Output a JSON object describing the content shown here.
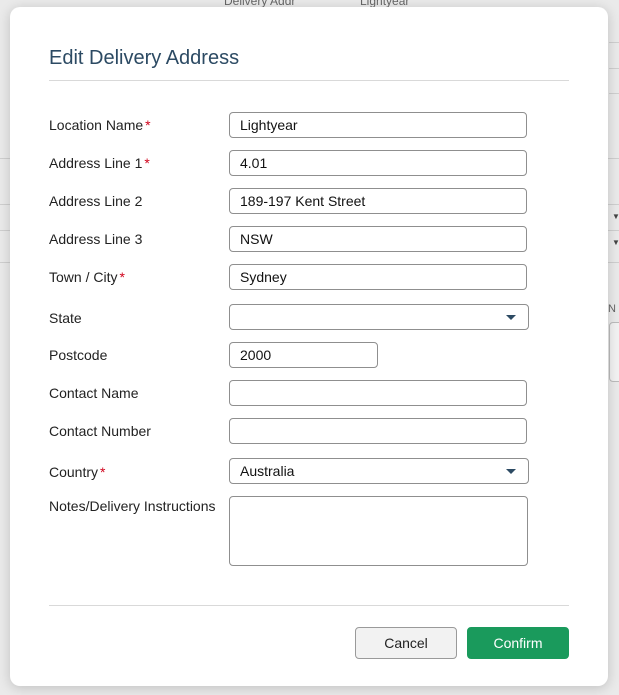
{
  "background": {
    "top_left_text": "Delivery Addr",
    "top_right_text": "Lightyear",
    "right_label": "N"
  },
  "modal": {
    "title": "Edit Delivery Address",
    "fields": {
      "location_name": {
        "label": "Location Name",
        "required": "*",
        "value": "Lightyear"
      },
      "address_line_1": {
        "label": "Address Line 1",
        "required": "*",
        "value": "4.01"
      },
      "address_line_2": {
        "label": "Address Line 2",
        "value": "189-197 Kent Street"
      },
      "address_line_3": {
        "label": "Address Line 3",
        "value": "NSW"
      },
      "town_city": {
        "label": "Town / City",
        "required": "*",
        "value": "Sydney"
      },
      "state": {
        "label": "State",
        "value": ""
      },
      "postcode": {
        "label": "Postcode",
        "value": "2000"
      },
      "contact_name": {
        "label": "Contact Name",
        "value": ""
      },
      "contact_number": {
        "label": "Contact Number",
        "value": ""
      },
      "country": {
        "label": "Country",
        "required": "*",
        "value": "Australia"
      },
      "notes": {
        "label": "Notes/Delivery Instructions",
        "value": ""
      }
    },
    "buttons": {
      "cancel": "Cancel",
      "confirm": "Confirm"
    }
  },
  "colors": {
    "title": "#2c4a63",
    "required": "#d0021b",
    "confirm": "#1a9a5c"
  }
}
